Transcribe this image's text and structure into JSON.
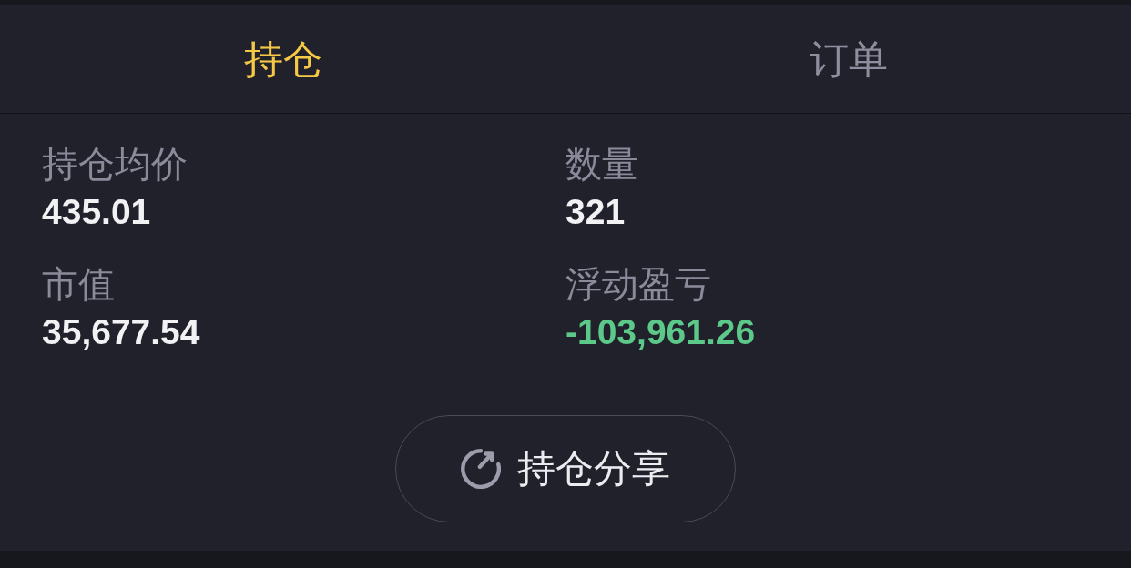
{
  "tabs": [
    {
      "label": "持仓",
      "selected": true
    },
    {
      "label": "订单",
      "selected": false
    }
  ],
  "stats": [
    {
      "label": "持仓均价",
      "value": "435.01",
      "color": "#f2f2f5"
    },
    {
      "label": "数量",
      "value": "321",
      "color": "#f2f2f5"
    },
    {
      "label": "市值",
      "value": "35,677.54",
      "color": "#f2f2f5"
    },
    {
      "label": "浮动盈亏",
      "value": "-103,961.26",
      "color": "#5cc98a"
    }
  ],
  "share_button": {
    "label": "持仓分享"
  }
}
